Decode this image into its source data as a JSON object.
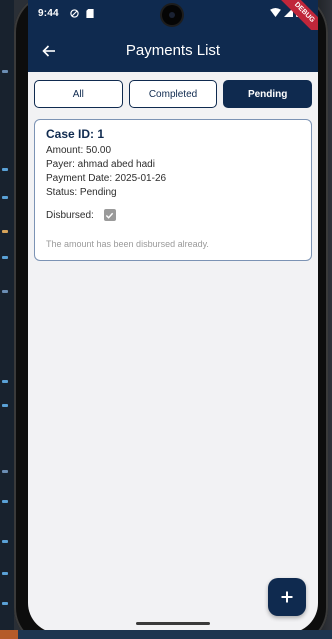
{
  "status_bar": {
    "time": "9:44",
    "left_icons": [
      "dnd-icon",
      "sim-card-icon"
    ],
    "right_icons": [
      "wifi-icon",
      "signal-icon",
      "battery-icon"
    ],
    "debug_label": "DEBUG"
  },
  "app_bar": {
    "title": "Payments List",
    "back_icon": "back-arrow-icon"
  },
  "filters": {
    "tabs": [
      {
        "label": "All",
        "active": false
      },
      {
        "label": "Completed",
        "active": false
      },
      {
        "label": "Pending",
        "active": true
      }
    ]
  },
  "payments": [
    {
      "case_id": "Case ID: 1",
      "amount": "Amount: 50.00",
      "payer": "Payer: ahmad abed hadi",
      "payment_date": "Payment Date: 2025-01-26",
      "status": "Status: Pending",
      "disbursed_label": "Disbursed:",
      "disbursed": true,
      "note": "The amount has been disbursed already."
    }
  ],
  "fab": {
    "icon": "plus-icon"
  },
  "colors": {
    "primary": "#0f2a4f",
    "card_border": "#7c93b4",
    "background": "#f2f2f4",
    "muted_text": "#9a9a9a",
    "checkbox_disabled": "#9a9a9a",
    "debug_ribbon": "#c0263a"
  }
}
